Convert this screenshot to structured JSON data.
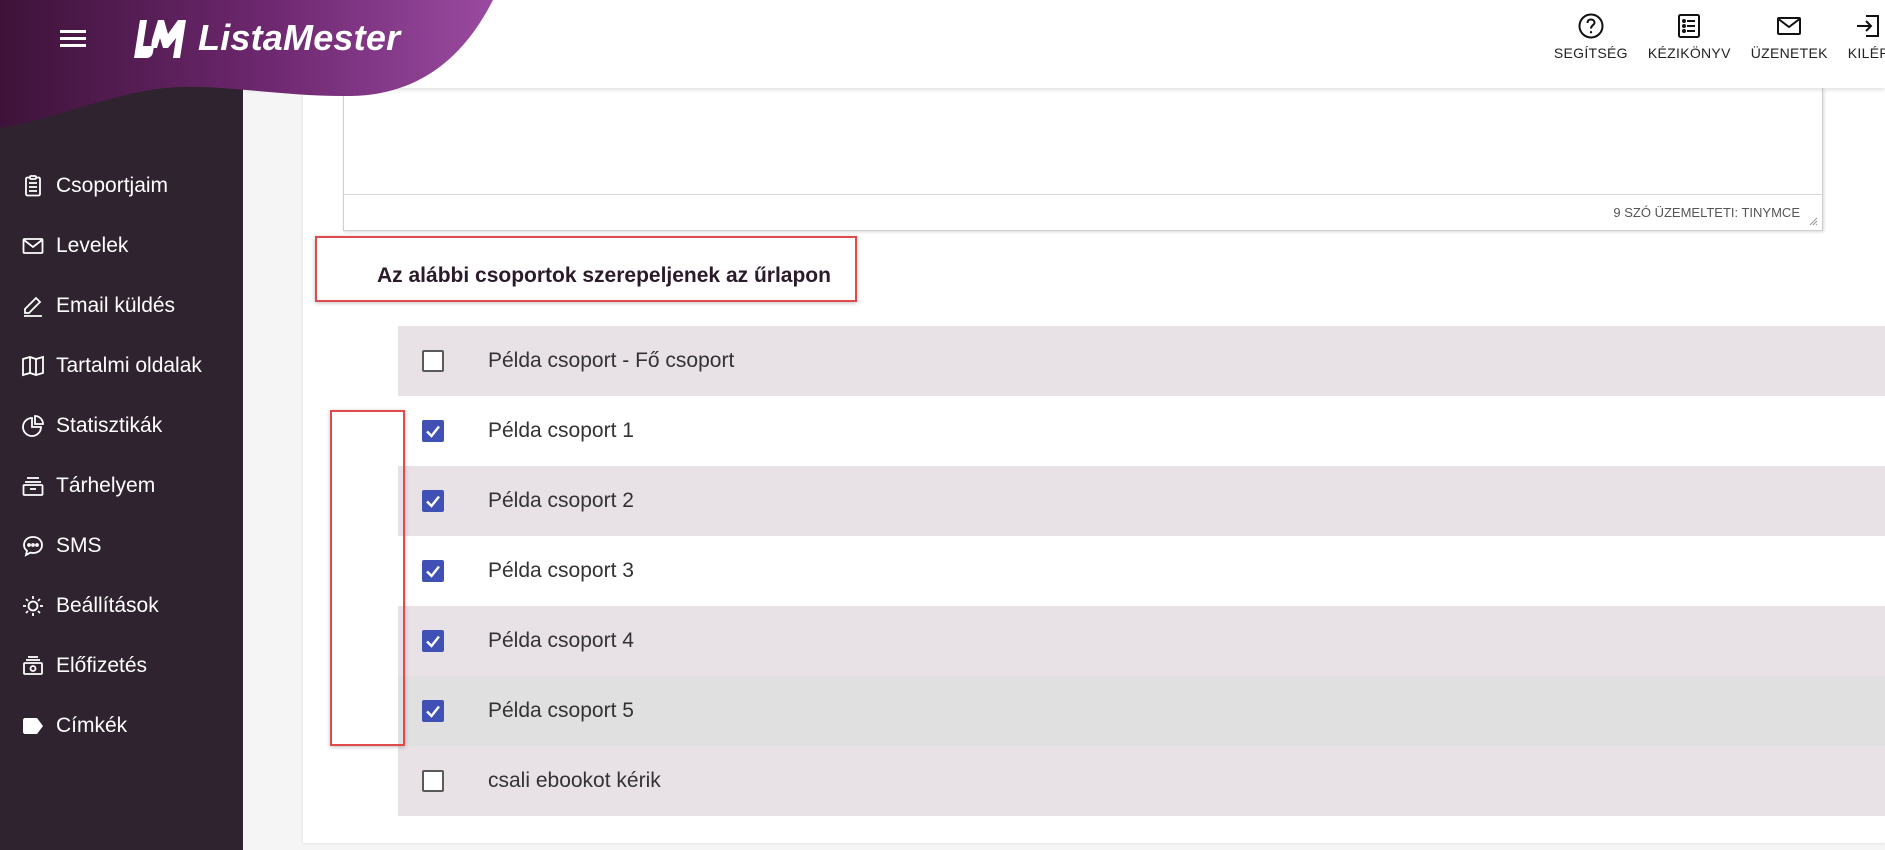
{
  "app": {
    "name": "ListaMester",
    "brand_color": "#7a2f7f",
    "sidebar_bg": "#2e232e",
    "accent": "#3f51b5",
    "highlight": "#e04a4a"
  },
  "sidebar": {
    "items": [
      {
        "label": "Csoportjaim",
        "icon": "clipboard-list-icon"
      },
      {
        "label": "Levelek",
        "icon": "envelope-icon"
      },
      {
        "label": "Email küldés",
        "icon": "pen-icon"
      },
      {
        "label": "Tartalmi oldalak",
        "icon": "book-open-icon"
      },
      {
        "label": "Statisztikák",
        "icon": "pie-chart-icon"
      },
      {
        "label": "Tárhelyem",
        "icon": "archive-icon"
      },
      {
        "label": "SMS",
        "icon": "chat-bubble-icon"
      },
      {
        "label": "Beállítások",
        "icon": "gear-icon"
      },
      {
        "label": "Előfizetés",
        "icon": "cash-icon"
      },
      {
        "label": "Címkék",
        "icon": "tag-icon"
      }
    ]
  },
  "topbar": {
    "help": "SEGÍTSÉG",
    "manual": "KÉZIKÖNYV",
    "messages": "ÜZENETEK",
    "logout": "KILÉP"
  },
  "editor": {
    "status": "9 SZÓ ÜZEMELTETI: TINYMCE"
  },
  "groups_section": {
    "title": "Az alábbi csoportok szerepeljenek az űrlapon",
    "groups": [
      {
        "label": "Példa csoport - Fő csoport",
        "checked": false
      },
      {
        "label": "Példa csoport 1",
        "checked": true
      },
      {
        "label": "Példa csoport 2",
        "checked": true
      },
      {
        "label": "Példa csoport 3",
        "checked": true
      },
      {
        "label": "Példa csoport 4",
        "checked": true
      },
      {
        "label": "Példa csoport 5",
        "checked": true
      },
      {
        "label": "csali ebookot kérik",
        "checked": false
      }
    ]
  }
}
